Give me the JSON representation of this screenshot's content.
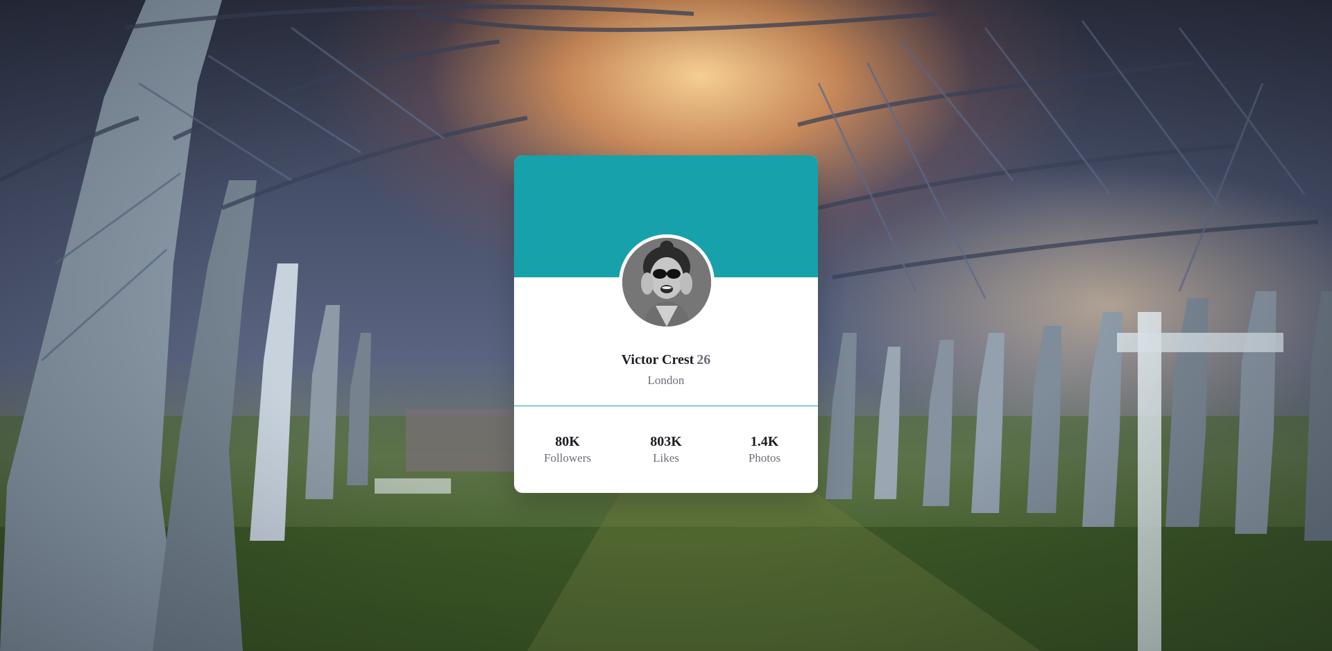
{
  "profile": {
    "name": "Victor Crest",
    "age": "26",
    "city": "London",
    "avatar_icon": "profile-photo"
  },
  "stats": [
    {
      "value": "80K",
      "label": "Followers"
    },
    {
      "value": "803K",
      "label": "Likes"
    },
    {
      "value": "1.4K",
      "label": "Photos"
    }
  ],
  "colors": {
    "accent": "#17a1ab",
    "card": "#ffffff",
    "text_primary": "#1b1d22",
    "text_muted": "#6b6e78"
  }
}
